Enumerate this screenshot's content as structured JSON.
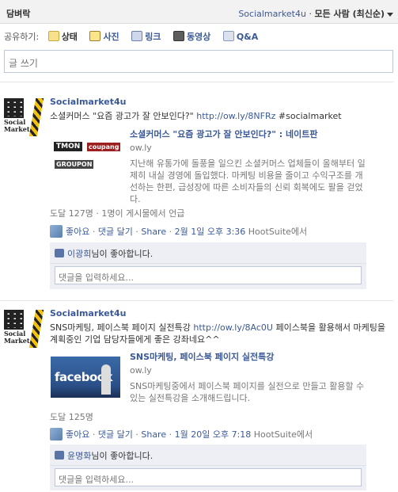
{
  "header": {
    "title": "담벼락",
    "page_name": "Socialmarket4u",
    "separator": "·",
    "filter_label": "모든 사람 (최신순)"
  },
  "share_bar": {
    "label": "공유하기:",
    "items": [
      {
        "label": "상태",
        "icon": "status-icon"
      },
      {
        "label": "사진",
        "icon": "photo-icon"
      },
      {
        "label": "링크",
        "icon": "link-icon"
      },
      {
        "label": "동영상",
        "icon": "video-icon"
      },
      {
        "label": "Q&A",
        "icon": "qa-icon"
      }
    ]
  },
  "composer": {
    "placeholder": "글 쓰기"
  },
  "posts": [
    {
      "author": "Socialmarket4u",
      "avatar_text": "Social Market",
      "message_text": "소셜커머스 \"요즘 광고가 잘 안보인다?\" ",
      "message_link": "http://ow.ly/8NFRz",
      "message_tail": " #socialmarket",
      "attachment": {
        "thumb_labels": [
          "TMON",
          "coupang",
          "GROUPON"
        ],
        "title": "소셜커머스 \"요즘 광고가 잘 안보인다?\" : 네이트판",
        "domain": "ow.ly",
        "description": "지난해 유통가에 돌풍을 일으킨 소셜커머스 업체들이 올해부터 일제히 내실 경영에 돌입했다. 마케팅 비용을 줄이고 수익구조를 개선하는 한편, 급성장에 따른 소비자들의 신뢰 회복에도 팔을 걷었다."
      },
      "meta": "도달 127명 · 1명이 게시물에서 언급",
      "actions": {
        "like": "좋아요",
        "comment": "댓글 달기",
        "share": "Share",
        "timestamp": "2월 1일 오후 3:36",
        "via": "HootSuite에서",
        "dot": "·"
      },
      "likes": {
        "name": "이광희",
        "suffix": "님이 좋아합니다."
      },
      "comment_placeholder": "댓글을 입력하세요..."
    },
    {
      "author": "Socialmarket4u",
      "avatar_text": "Social Market",
      "message_text": "SNS마케팅, 페이스북 페이지 실전특강 ",
      "message_link": "http://ow.ly/8Ac0U",
      "message_tail": " 페이스북을 활용해서 마케팅을 계획중인 기업 담당자들에게 좋은 강좌네요^^",
      "attachment": {
        "thumb_labels": [
          "facebook"
        ],
        "title": "SNS마케팅, 페이스북 페이지 실전특강",
        "domain": "ow.ly",
        "description": "SNS마케팅중에서 페이스북 페이지를 실전으로 만들고 활용할 수 있는 실전특강을 소개해드립니다."
      },
      "meta": "도달 125명",
      "actions": {
        "like": "좋아요",
        "comment": "댓글 달기",
        "share": "Share",
        "timestamp": "1월 20일 오후 7:18",
        "via": "HootSuite에서",
        "dot": "·"
      },
      "likes": {
        "name": "윤명화",
        "suffix": "님이 좋아합니다."
      },
      "comment_placeholder": "댓글을 입력하세요..."
    }
  ],
  "colors": {
    "link": "#3b5998",
    "muted": "#777777",
    "ufi_bg": "#edeff4"
  }
}
